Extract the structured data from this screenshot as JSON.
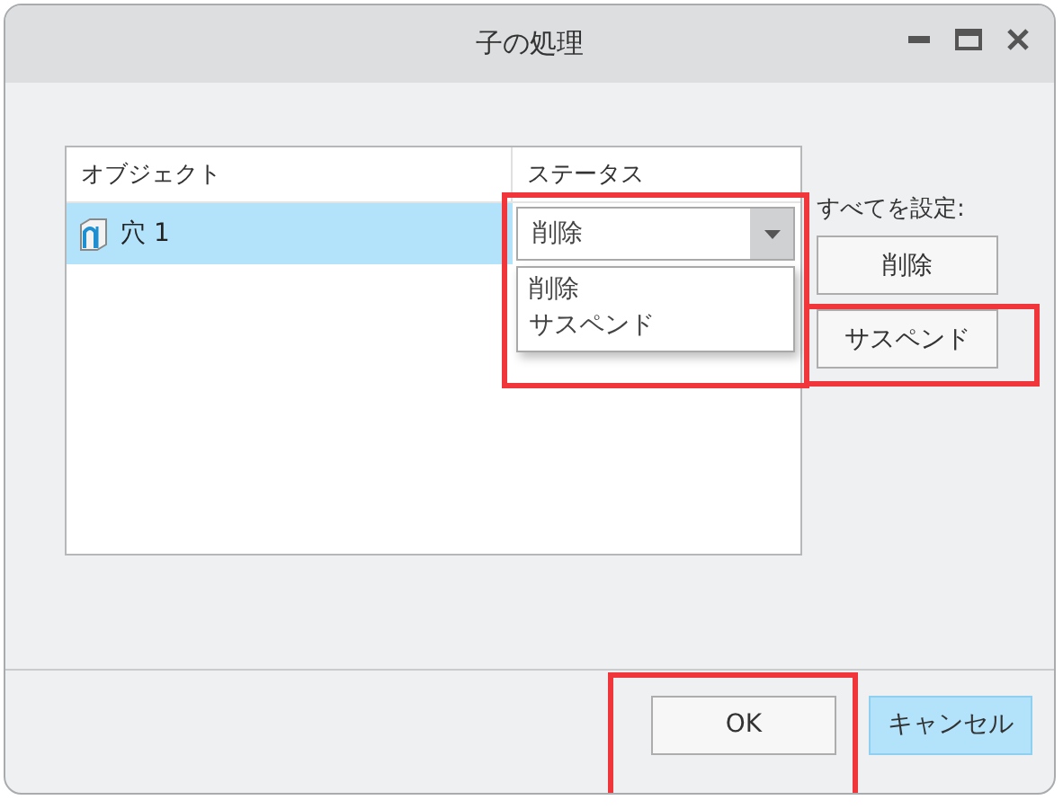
{
  "window": {
    "title": "子の処理"
  },
  "table": {
    "columns": [
      "オブジェクト",
      "ステータス"
    ],
    "rows": [
      {
        "object": "穴 1",
        "status": "削除",
        "selected": true
      }
    ]
  },
  "dropdown": {
    "options": [
      "削除",
      "サスペンド"
    ]
  },
  "set_all": {
    "label": "すべてを設定:",
    "buttons": [
      "削除",
      "サスペンド"
    ]
  },
  "buttons": [
    {
      "label": "OK",
      "focused": false
    },
    {
      "label": "キャンセル",
      "focused": true
    }
  ],
  "highlights": [
    {
      "kind": "frame"
    },
    {
      "kind": "frame"
    },
    {
      "kind": "frame"
    }
  ]
}
